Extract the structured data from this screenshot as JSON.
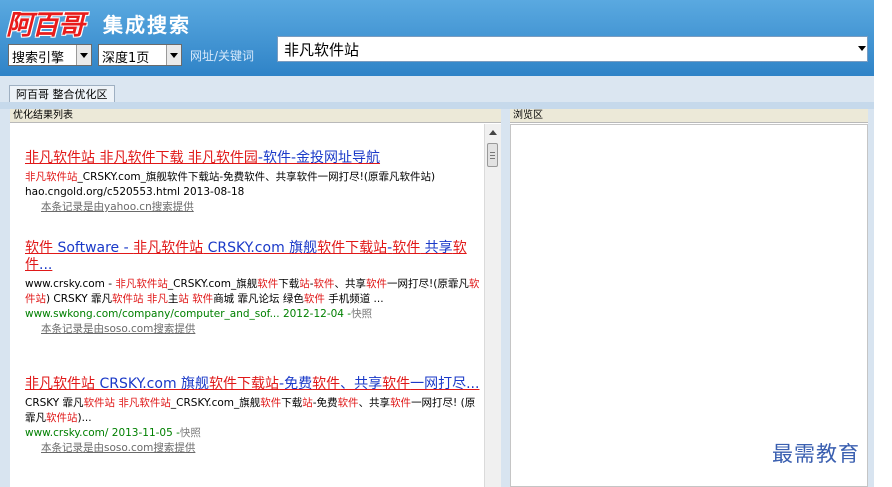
{
  "header": {
    "logo_text": "阿百哥",
    "app_title": "集成搜索",
    "engine_select": "搜索引擎",
    "depth_select": "深度1页",
    "url_label": "网址/关键词",
    "url_value": "非凡软件站"
  },
  "tabs": [
    {
      "label": "阿百哥 整合优化区"
    }
  ],
  "left_panel": {
    "title": "优化结果列表",
    "results": [
      {
        "title": [
          [
            "非凡软件站 非凡软件下载 非凡软件园",
            "kw"
          ],
          [
            "-软件-金投网址导航",
            "bl"
          ]
        ],
        "desc": [
          [
            "非凡软件站",
            "kw"
          ],
          [
            "_CRSKY.com_旗舰软件下载站-免费软件、共享软件一网打尽!(原霏凡软件站)",
            ""
          ]
        ],
        "url": [
          [
            "hao.cngold.org/c520553.html 2013-08-18",
            ""
          ]
        ],
        "url_color": "black",
        "source": "本条记录是由yahoo.cn搜索提供"
      },
      {
        "title": [
          [
            "软件",
            "kw"
          ],
          [
            " Software - ",
            "bl"
          ],
          [
            "非凡软件站",
            "kw"
          ],
          [
            " CRSKY.com 旗舰",
            "bl"
          ],
          [
            "软件下载站",
            "kw"
          ],
          [
            "-",
            "bl"
          ],
          [
            "软件",
            "kw"
          ],
          [
            " 共享",
            "bl"
          ],
          [
            "软件",
            "kw"
          ],
          [
            "...",
            "bl"
          ]
        ],
        "desc": [
          [
            "www.crsky.com - ",
            ""
          ],
          [
            "非凡软件站",
            "kw"
          ],
          [
            "_CRSKY.com_旗舰",
            ""
          ],
          [
            "软件",
            "kw"
          ],
          [
            "下载",
            ""
          ],
          [
            "站",
            "kw"
          ],
          [
            "-",
            ""
          ],
          [
            "软件",
            "kw"
          ],
          [
            "、共享",
            ""
          ],
          [
            "软件",
            "kw"
          ],
          [
            "一网打尽!(原霏凡",
            ""
          ],
          [
            "软件站",
            "kw"
          ],
          [
            ") CRSKY 霏凡",
            ""
          ],
          [
            "软件站",
            "kw"
          ],
          [
            " ",
            ""
          ],
          [
            "非凡",
            "kw"
          ],
          [
            "主",
            ""
          ],
          [
            "站",
            "kw"
          ],
          [
            " ",
            ""
          ],
          [
            "软件",
            "kw"
          ],
          [
            "商城 霏凡论坛 绿色",
            ""
          ],
          [
            "软件",
            "kw"
          ],
          [
            " 手机频道 ...",
            ""
          ]
        ],
        "url": [
          [
            "www.swkong.com/company/computer_and_sof... 2012-12-04 -",
            ""
          ],
          [
            "快照",
            "gray"
          ]
        ],
        "url_color": "green",
        "source": "本条记录是由soso.com搜索提供"
      },
      {
        "title": [
          [
            "非凡软件站",
            "kw"
          ],
          [
            " CRSKY.com 旗舰",
            "bl"
          ],
          [
            "软件下载站",
            "kw"
          ],
          [
            "-免费",
            "bl"
          ],
          [
            "软件",
            "kw"
          ],
          [
            "、共享",
            "bl"
          ],
          [
            "软件",
            "kw"
          ],
          [
            "一网打尽...",
            "bl"
          ]
        ],
        "desc": [
          [
            "CRSKY 霏凡",
            ""
          ],
          [
            "软件站",
            "kw"
          ],
          [
            " ",
            ""
          ],
          [
            "非凡软件站",
            "kw"
          ],
          [
            "_CRSKY.com_旗舰",
            ""
          ],
          [
            "软件",
            "kw"
          ],
          [
            "下载",
            ""
          ],
          [
            "站",
            "kw"
          ],
          [
            "-免费",
            ""
          ],
          [
            "软件",
            "kw"
          ],
          [
            "、共享",
            ""
          ],
          [
            "软件",
            "kw"
          ],
          [
            "一网打尽! (原霏凡",
            ""
          ],
          [
            "软件站",
            "kw"
          ],
          [
            ")...",
            ""
          ]
        ],
        "url": [
          [
            "www.crsky.com/ 2013-11-05 -",
            ""
          ],
          [
            "快照",
            "gray"
          ]
        ],
        "url_color": "green",
        "source": "本条记录是由soso.com搜索提供"
      }
    ]
  },
  "right_panel": {
    "title": "浏览区"
  },
  "watermark": "最需教育",
  "colors": {
    "header_blue": "#3a8fd2",
    "keyword_red": "#e01818",
    "link_blue": "#1a39c8",
    "url_green": "#008000"
  }
}
